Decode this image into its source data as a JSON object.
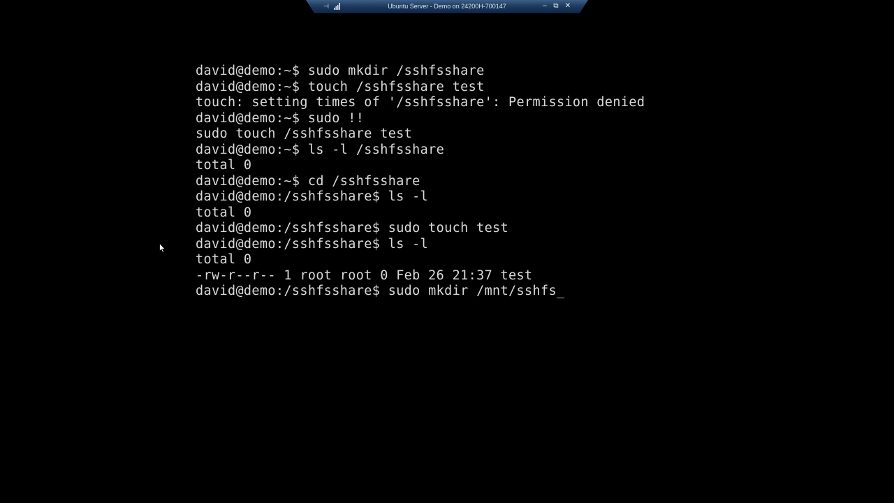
{
  "connection_bar": {
    "title": "Ubuntu Server - Demo on 24200H-700147",
    "pin_icon": "pin-icon",
    "signal_icon": "signal-strength-icon",
    "minimize_icon": "minimize-icon",
    "restore_icon": "restore-icon",
    "close_icon": "close-icon"
  },
  "terminal": {
    "lines": [
      "david@demo:~$ sudo mkdir /sshfsshare",
      "david@demo:~$ touch /sshfsshare test",
      "touch: setting times of '/sshfsshare': Permission denied",
      "david@demo:~$ sudo !!",
      "sudo touch /sshfsshare test",
      "david@demo:~$ ls -l /sshfsshare",
      "total 0",
      "david@demo:~$ cd /sshfsshare",
      "david@demo:/sshfsshare$ ls -l",
      "total 0",
      "david@demo:/sshfsshare$ sudo touch test",
      "david@demo:/sshfsshare$ ls -l",
      "total 0",
      "-rw-r--r-- 1 root root 0 Feb 26 21:37 test",
      "david@demo:/sshfsshare$ sudo mkdir /mnt/sshfs"
    ],
    "cursor": "_"
  },
  "colors": {
    "background": "#000000",
    "terminal_text": "#d9d9d9",
    "bar_top": "#3d5f86",
    "bar_bottom": "#0f2444"
  }
}
